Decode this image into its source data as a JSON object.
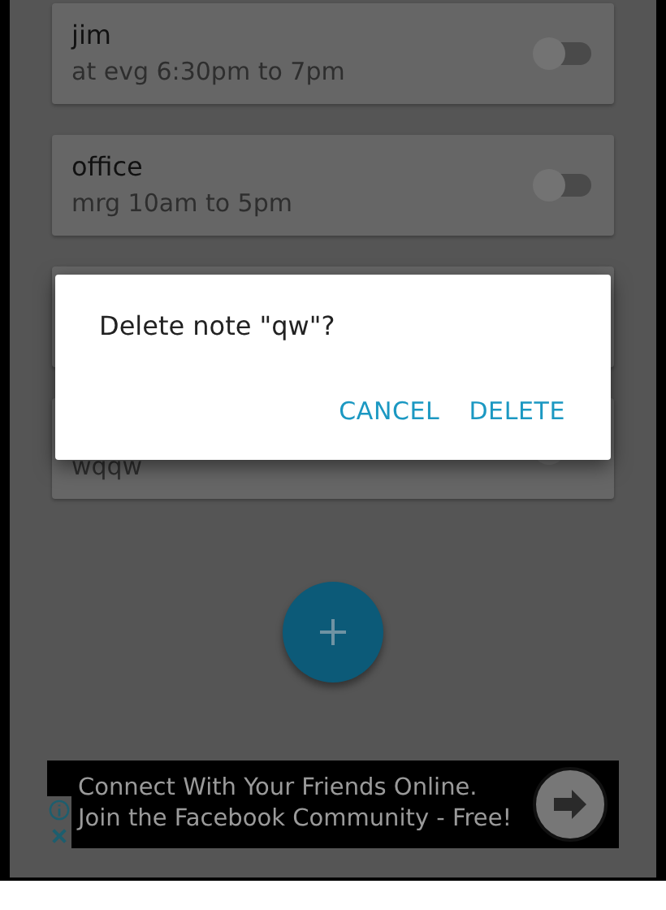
{
  "notes": [
    {
      "kind": "note",
      "title": "jim",
      "subtitle": "at evg 6:30pm  to 7pm",
      "on": false
    },
    {
      "kind": "note",
      "title": "office",
      "subtitle": "mrg 10am  to 5pm",
      "on": false
    },
    {
      "kind": "note"
    },
    {
      "kind": "note",
      "subtitle": "wqqw",
      "on": false
    }
  ],
  "dialog": {
    "message": "Delete note \"qw\"?",
    "buttons": [
      "CANCEL",
      "DELETE"
    ]
  },
  "ad": {
    "lines": [
      "Connect With Your Friends Online.",
      "Join the Facebook Community - Free!"
    ]
  }
}
